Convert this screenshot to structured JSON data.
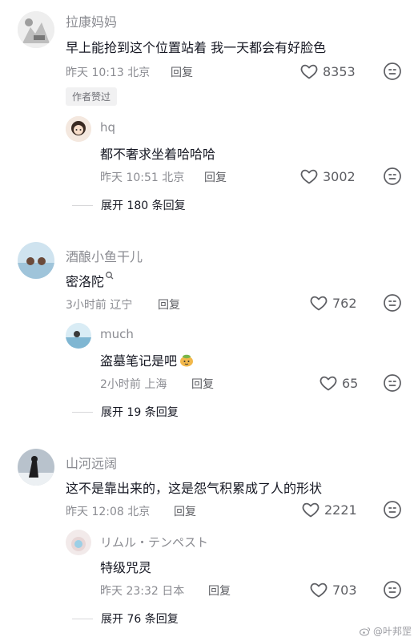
{
  "threads": [
    {
      "name": "拉康妈妈",
      "text": "早上能抢到这个位置站着 我一天都会有好脸色",
      "meta": "昨天 10:13 北京",
      "reply_label": "回复",
      "likes": "8353",
      "badge": "作者赞过",
      "reply": {
        "name": "hq",
        "text": "都不奢求坐着哈哈哈",
        "meta": "昨天 10:51 北京",
        "reply_label": "回复",
        "likes": "3002"
      },
      "expand": "展开 180 条回复"
    },
    {
      "name": "酒酿小鱼干儿",
      "text": "密洛陀",
      "meta": "3小时前 辽宁",
      "reply_label": "回复",
      "likes": "762",
      "reply": {
        "name": "much",
        "text": "盗墓笔记是吧",
        "meta": "2小时前 上海",
        "reply_label": "回复",
        "likes": "65"
      },
      "expand": "展开 19 条回复"
    },
    {
      "name": "山河远阔",
      "text": "这不是靠出来的，这是怨气积累成了人的形状",
      "meta": "昨天 12:08 北京",
      "reply_label": "回复",
      "likes": "2221",
      "reply": {
        "name": "リムル・テンペスト",
        "text": "特级咒灵",
        "meta": "昨天 23:32 日本",
        "reply_label": "回复",
        "likes": "703"
      },
      "expand": "展开 76 条回复"
    }
  ],
  "watermark": "@叶邦罡",
  "icons": {
    "like": "heart-outline-icon",
    "emoji": "smiley-face-icon",
    "search": "search-icon",
    "pot": "cartoon-pot-emoji"
  },
  "colors": {
    "primary_text": "#161823",
    "secondary_text": "#8a8b91",
    "badge_bg": "#f1f1f2"
  }
}
